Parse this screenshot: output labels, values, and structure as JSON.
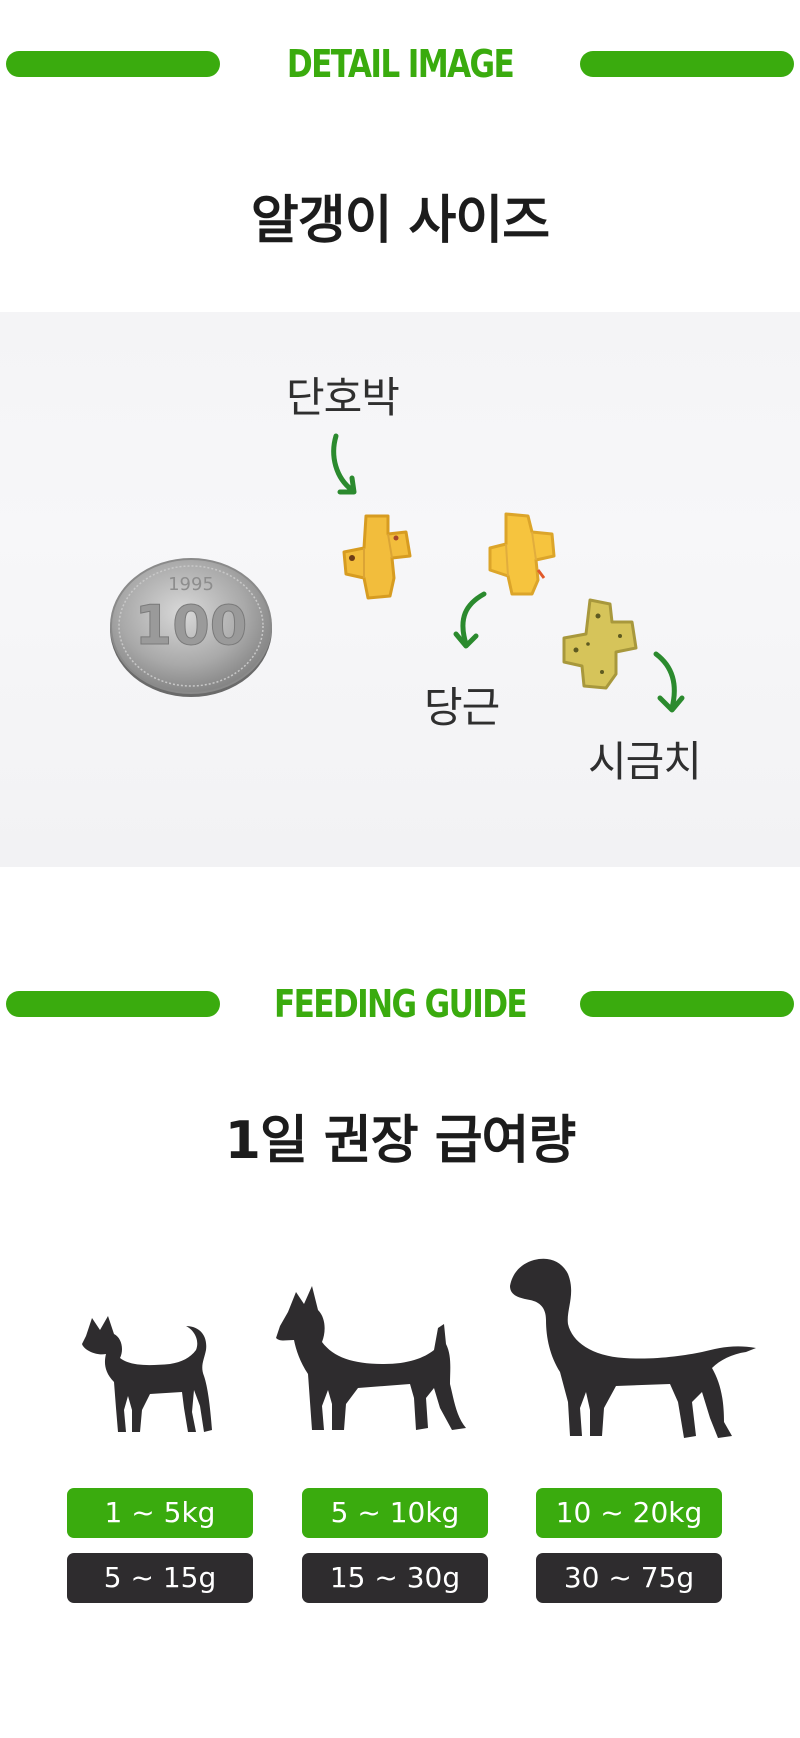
{
  "detail": {
    "section_label": "DETAIL IMAGE",
    "title": "알갱이 사이즈",
    "labels": {
      "pumpkin": "단호박",
      "carrot": "당근",
      "spinach": "시금치"
    },
    "coin": {
      "value": "100",
      "year": "1995"
    }
  },
  "feeding": {
    "section_label": "FEEDING GUIDE",
    "title": "1일 권장 급여량",
    "dogs": [
      {
        "icon": "small-dog-icon",
        "weight": "1 ~ 5kg",
        "amount": "5 ~ 15g"
      },
      {
        "icon": "medium-dog-icon",
        "weight": "5 ~ 10kg",
        "amount": "15 ~ 30g"
      },
      {
        "icon": "large-dog-icon",
        "weight": "10 ~ 20kg",
        "amount": "30 ~ 75g"
      }
    ]
  },
  "colors": {
    "accent": "#3aab0e",
    "dark": "#2e2c2e",
    "text": "#1c1c1c"
  }
}
